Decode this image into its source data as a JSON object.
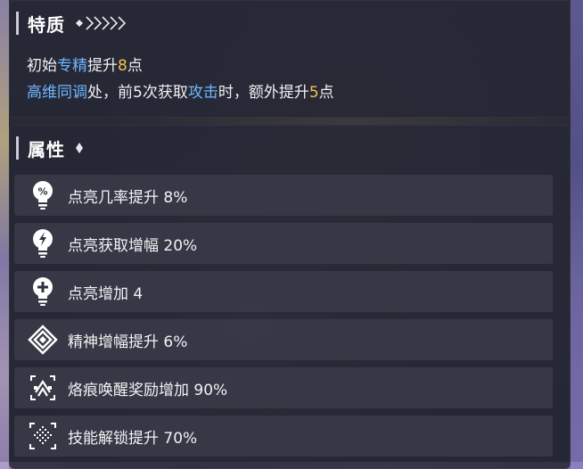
{
  "traits": {
    "title": "特质",
    "line1": {
      "p1": "初始",
      "p2": "专精",
      "p3": "提升",
      "p4": "8",
      "p5": "点"
    },
    "line2": {
      "p1": "高维同调",
      "p2": "处，前5次获取",
      "p3": "攻击",
      "p4": "时，额外提升",
      "p5": "5",
      "p6": "点"
    }
  },
  "attributes": {
    "title": "属性",
    "items": [
      {
        "icon": "percent-bulb-icon",
        "label": "点亮几率提升 8%"
      },
      {
        "icon": "lightning-bulb-icon",
        "label": "点亮获取增幅 20%"
      },
      {
        "icon": "plus-bulb-icon",
        "label": "点亮增加 4"
      },
      {
        "icon": "spirit-diamond-icon",
        "label": "精神增幅提升 6%"
      },
      {
        "icon": "brand-frame-icon",
        "label": "烙痕唤醒奖励增加 90%"
      },
      {
        "icon": "skill-unlock-icon",
        "label": "技能解锁提升 70%"
      }
    ]
  },
  "colors": {
    "highlight_blue": "#6fb6ff",
    "highlight_gold": "#f3c24a"
  }
}
